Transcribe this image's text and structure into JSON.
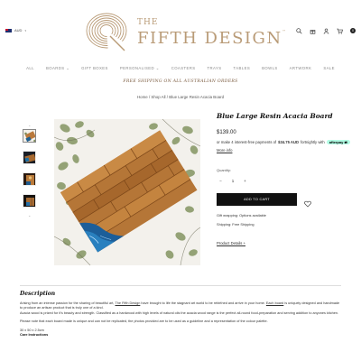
{
  "header": {
    "currency": "AUD",
    "logo": {
      "the": "THE",
      "name": "FIFTH DESIGN",
      "tm": "™"
    },
    "icons": [
      "search-icon",
      "gift-icon",
      "user-icon",
      "cart-icon"
    ],
    "cart_count": "0"
  },
  "nav": {
    "items": [
      "ALL",
      "BOARDS",
      "GIFT BOXES",
      "PERSONALISED",
      "COASTERS",
      "TRAYS",
      "TABLES",
      "BOWLS",
      "ARTWORK",
      "SALE"
    ]
  },
  "promo": "FREE SHIPPING ON ALL AUSTRALIAN ORDERS",
  "breadcrumb": {
    "home": "Home",
    "shop": "Shop All",
    "current": "Blue Large Resin Acacia Board",
    "separator": "/"
  },
  "product": {
    "title": "Blue Large Resin Acacia Board",
    "price": "$139.00",
    "afterpay": {
      "prefix": "or make 4 interest-free payments of",
      "amount": "$34.75 AUD",
      "suffix": "fortnightly with",
      "badge": "afterpay",
      "more": "More info"
    },
    "quantity_label": "Quantity:",
    "quantity": "1",
    "minus": "−",
    "plus": "+",
    "add_to_cart": "ADD TO CART",
    "gift_wrapping": "Gift wrapping: Options available",
    "shipping": "Shipping: Free Shipping",
    "details": "Product Details +"
  },
  "description": {
    "title": "Description",
    "p1_a": "Arising from an intense passion for the sharing of beautiful art,",
    "p1_link": "The Fifth Design",
    "p1_b": "have brought to life the stagnant art world to be rebirthed and arrive in your home.",
    "p1_link2": "Each board",
    "p1_c": "is uniquely designed and handmade to produce an artisan product that is truly one of a kind.",
    "p2": "Acacia wood is prized for it's beauty and strength. Classified as a hardwood with high levels of natural oils the acacia wood range is the perfect all-round food-preparation and serving addition to anyones kitchen.",
    "p3": "Please note that each board made is unique and can not be replicated, the photos provided are to be used as a guideline and a representation of the colour palette.",
    "dimensions": "30 x 50 x 2.5cm",
    "care": "Care Instructions"
  },
  "colors": {
    "brand": "#b99b77",
    "promo": "#7a5a3e",
    "button": "#111111",
    "afterpay": "#b2fce4"
  }
}
